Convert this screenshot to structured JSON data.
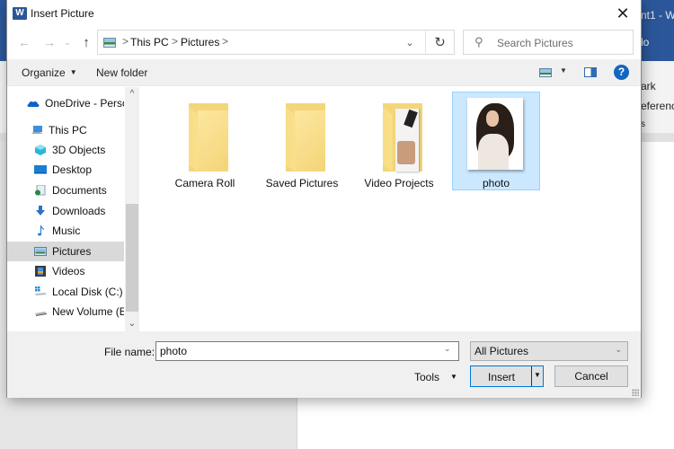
{
  "background_app": {
    "title_fragment": "nt1 - W",
    "tab_fragment": "lo",
    "ribbon_fragments": [
      "ark",
      "eferenc",
      "s"
    ]
  },
  "dialog": {
    "title": "Insert Picture",
    "app_icon_letter": "W",
    "close_glyph": "✕"
  },
  "navigation": {
    "back_glyph": "←",
    "forward_glyph": "→",
    "recent_glyph": "⌄",
    "up_glyph": "↑",
    "breadcrumb": [
      "This PC",
      "Pictures"
    ],
    "separator_glyph": ">",
    "dropdown_glyph": "⌄",
    "refresh_glyph": "↻",
    "search_placeholder": "Search Pictures",
    "search_glyph": "⚲"
  },
  "toolbar": {
    "organize_label": "Organize",
    "new_folder_label": "New folder",
    "caret_glyph": "▼",
    "help_glyph": "?"
  },
  "sidebar": {
    "items": [
      {
        "label": "OneDrive - Personal",
        "icon": "onedrive-cloud-icon",
        "level": 0
      },
      {
        "label": "This PC",
        "icon": "this-pc-icon",
        "level": 0
      },
      {
        "label": "3D Objects",
        "icon": "3d-objects-icon",
        "level": 1
      },
      {
        "label": "Desktop",
        "icon": "desktop-icon",
        "level": 1
      },
      {
        "label": "Documents",
        "icon": "documents-icon",
        "level": 1
      },
      {
        "label": "Downloads",
        "icon": "downloads-icon",
        "level": 1
      },
      {
        "label": "Music",
        "icon": "music-icon",
        "level": 1
      },
      {
        "label": "Pictures",
        "icon": "pictures-icon",
        "level": 1,
        "selected": true
      },
      {
        "label": "Videos",
        "icon": "videos-icon",
        "level": 1
      },
      {
        "label": "Local Disk (C:)",
        "icon": "local-disk-icon",
        "level": 1
      },
      {
        "label": "New Volume (E:)",
        "icon": "drive-icon",
        "level": 1
      }
    ],
    "scroll_up_glyph": "^",
    "scroll_down_glyph": "⌄"
  },
  "files": [
    {
      "name": "Camera Roll",
      "type": "folder"
    },
    {
      "name": "Saved Pictures",
      "type": "folder"
    },
    {
      "name": "Video Projects",
      "type": "folder-with-preview"
    },
    {
      "name": "photo",
      "type": "image",
      "selected": true
    }
  ],
  "bottom": {
    "file_name_label": "File name:",
    "file_name_value": "photo",
    "file_type_value": "All Pictures",
    "dropdown_glyph": "⌄",
    "tools_label": "Tools",
    "insert_label": "Insert",
    "cancel_label": "Cancel",
    "caret_glyph": "▼"
  }
}
